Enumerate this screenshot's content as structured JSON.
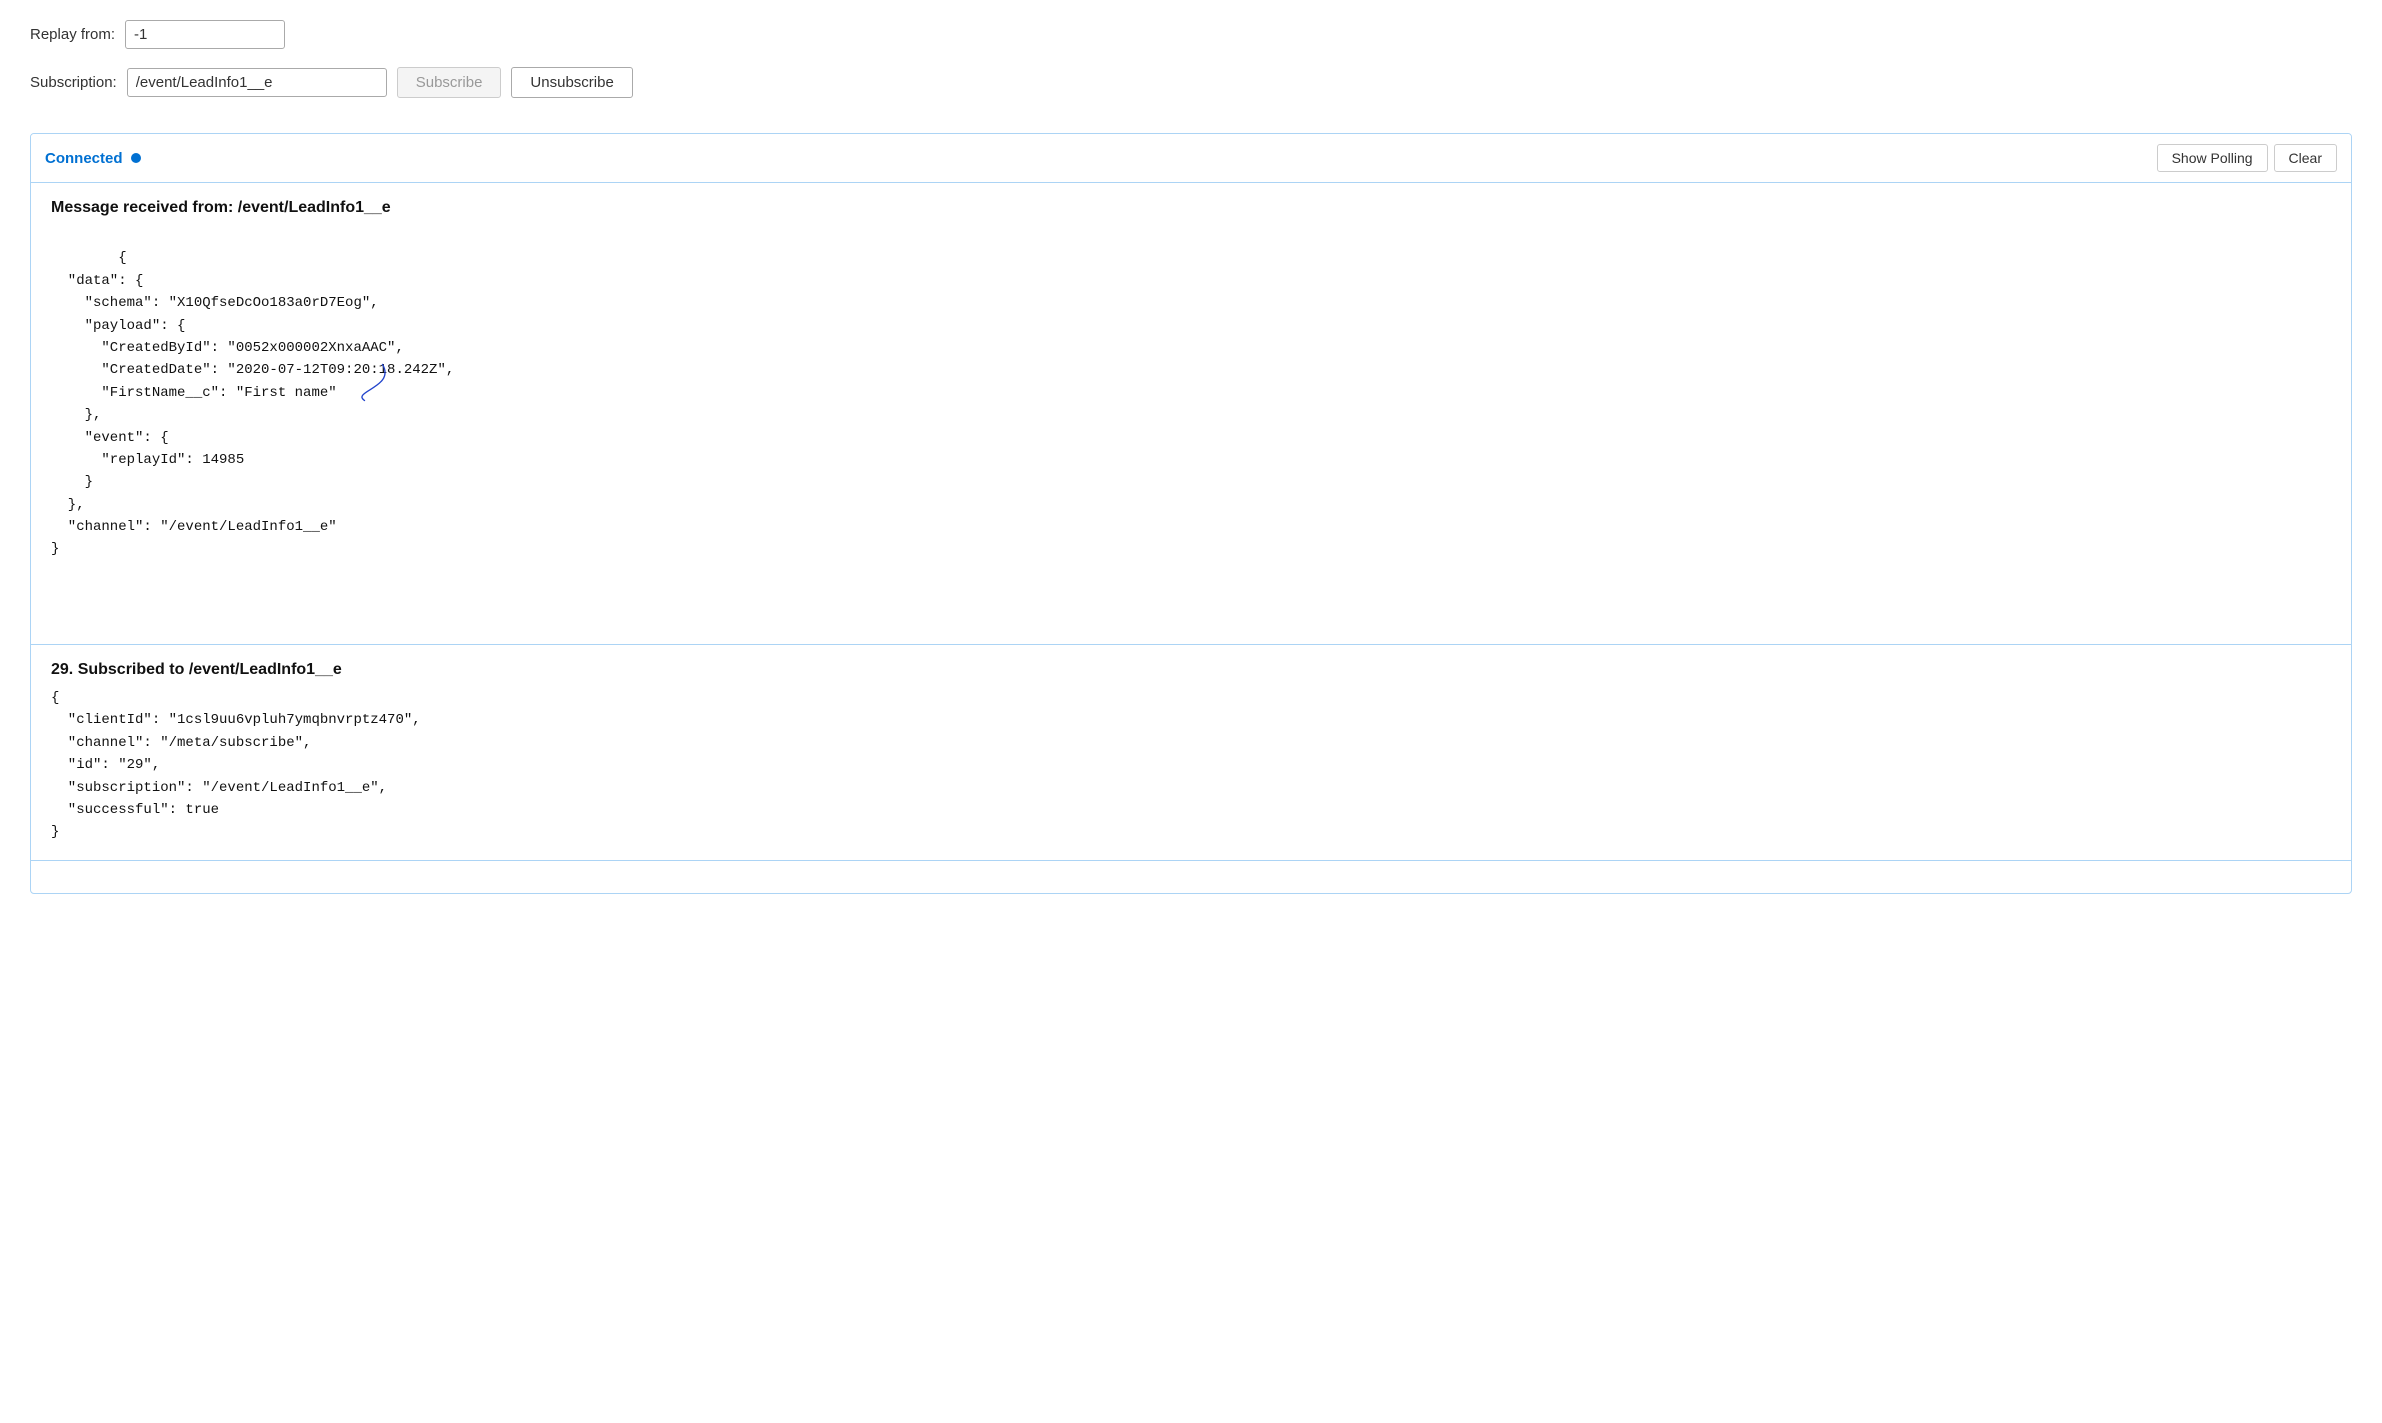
{
  "replay": {
    "label": "Replay from:",
    "value": "-1"
  },
  "subscription": {
    "label": "Subscription:",
    "value": "/event/LeadInfo1__e",
    "subscribe_label": "Subscribe",
    "unsubscribe_label": "Unsubscribe"
  },
  "panel": {
    "connected_label": "Connected",
    "show_polling_label": "Show Polling",
    "clear_label": "Clear"
  },
  "messages": [
    {
      "title": "Message received from: /event/LeadInfo1__e",
      "content": "{\n  \"data\": {\n    \"schema\": \"X10QfseDcOo183a0rD7Eog\",\n    \"payload\": {\n      \"CreatedById\": \"0052x000002XnxaAAC\",\n      \"CreatedDate\": \"2020-07-12T09:20:18.242Z\",\n      \"FirstName__c\": \"First name\"\n    },\n    \"event\": {\n      \"replayId\": 14985\n    }\n  },\n  \"channel\": \"/event/LeadInfo1__e\"\n}"
    },
    {
      "title": "29. Subscribed to /event/LeadInfo1__e",
      "content": "{\n  \"clientId\": \"1csl9uu6vpluh7ymqbnvrptz470\",\n  \"channel\": \"/meta/subscribe\",\n  \"id\": \"29\",\n  \"subscription\": \"/event/LeadInfo1__e\",\n  \"successful\": true\n}"
    }
  ]
}
